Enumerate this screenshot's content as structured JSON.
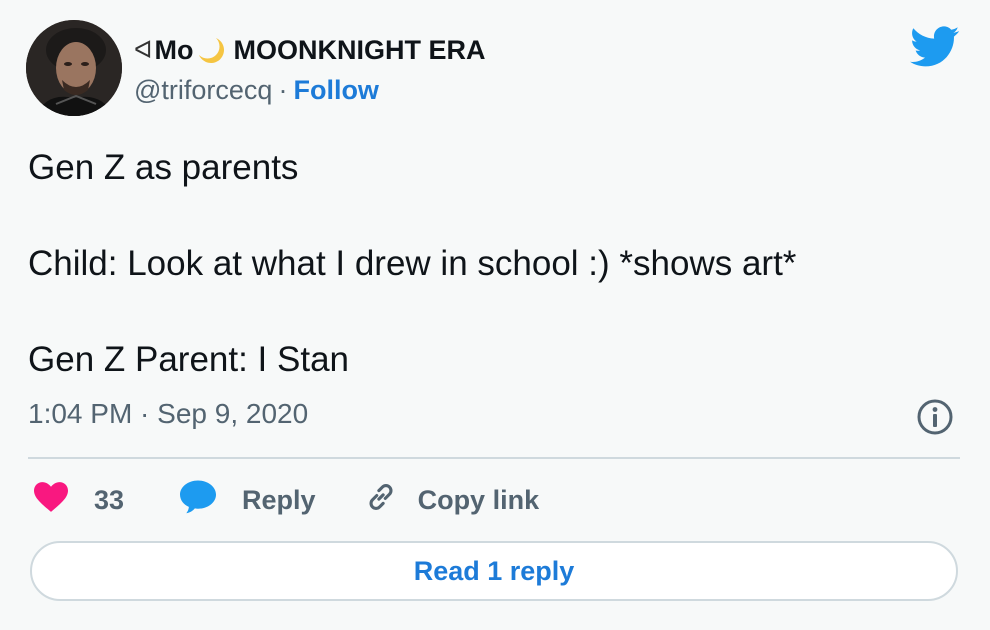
{
  "author": {
    "prefix_glyph": "ᐊ",
    "name": "Mo",
    "name_suffix": "MOONKNIGHT ERA",
    "moon_icon": "crescent-moon-icon",
    "handle": "@triforcecq",
    "separator": "·",
    "follow_label": "Follow"
  },
  "brand_icon": "twitter-bird-icon",
  "tweet": {
    "lines": [
      "Gen Z as parents",
      "Child: Look at what I drew in school :) *shows art*",
      "Gen Z Parent: I Stan"
    ],
    "timestamp": "1:04 PM · Sep 9, 2020"
  },
  "actions": {
    "like_count": "33",
    "reply_label": "Reply",
    "copy_label": "Copy link"
  },
  "read_replies_label": "Read 1 reply",
  "colors": {
    "accent": "#1d7bd8",
    "twitter_blue": "#1d9bf0",
    "like_pink": "#f91880",
    "muted_text": "#536471",
    "moon_yellow": "#f5c542"
  }
}
